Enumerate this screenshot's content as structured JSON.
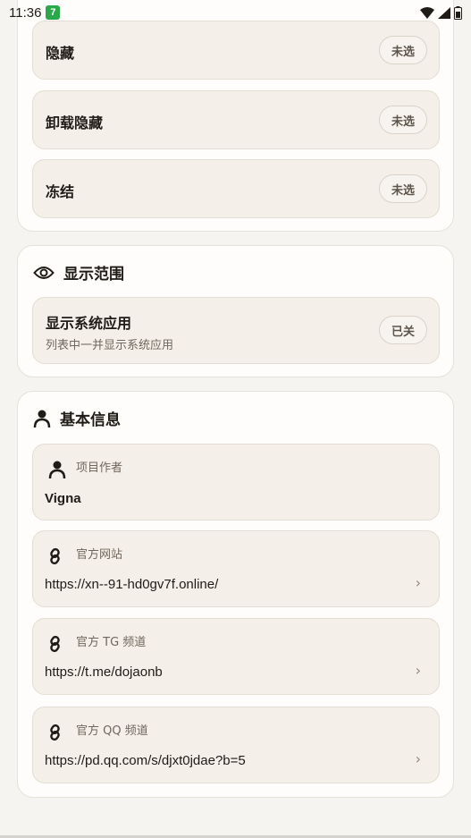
{
  "status_bar": {
    "time": "11:36",
    "badge": "7"
  },
  "mode_options": [
    {
      "label": "隐藏",
      "state": "未选"
    },
    {
      "label": "卸载隐藏",
      "state": "未选"
    },
    {
      "label": "冻结",
      "state": "未选"
    }
  ],
  "display_scope": {
    "title": "显示范围",
    "system_apps": {
      "title": "显示系统应用",
      "subtitle": "列表中一并显示系统应用",
      "state": "已关"
    }
  },
  "basic_info": {
    "title": "基本信息",
    "author": {
      "label": "项目作者",
      "value": "Vigna"
    },
    "website": {
      "label": "官方网站",
      "value": "https://xn--91-hd0gv7f.online/"
    },
    "tg": {
      "label": "官方 TG 频道",
      "value": "https://t.me/dojaonb"
    },
    "qq": {
      "label": "官方 QQ 频道",
      "value": "https://pd.qq.com/s/djxt0jdae?b=5"
    }
  },
  "icons": {
    "eye": "eye-icon",
    "person": "person-icon",
    "link": "link-icon",
    "chevron": "chevron-right-icon",
    "wifi": "wifi-icon",
    "signal": "signal-icon",
    "battery": "battery-icon"
  }
}
